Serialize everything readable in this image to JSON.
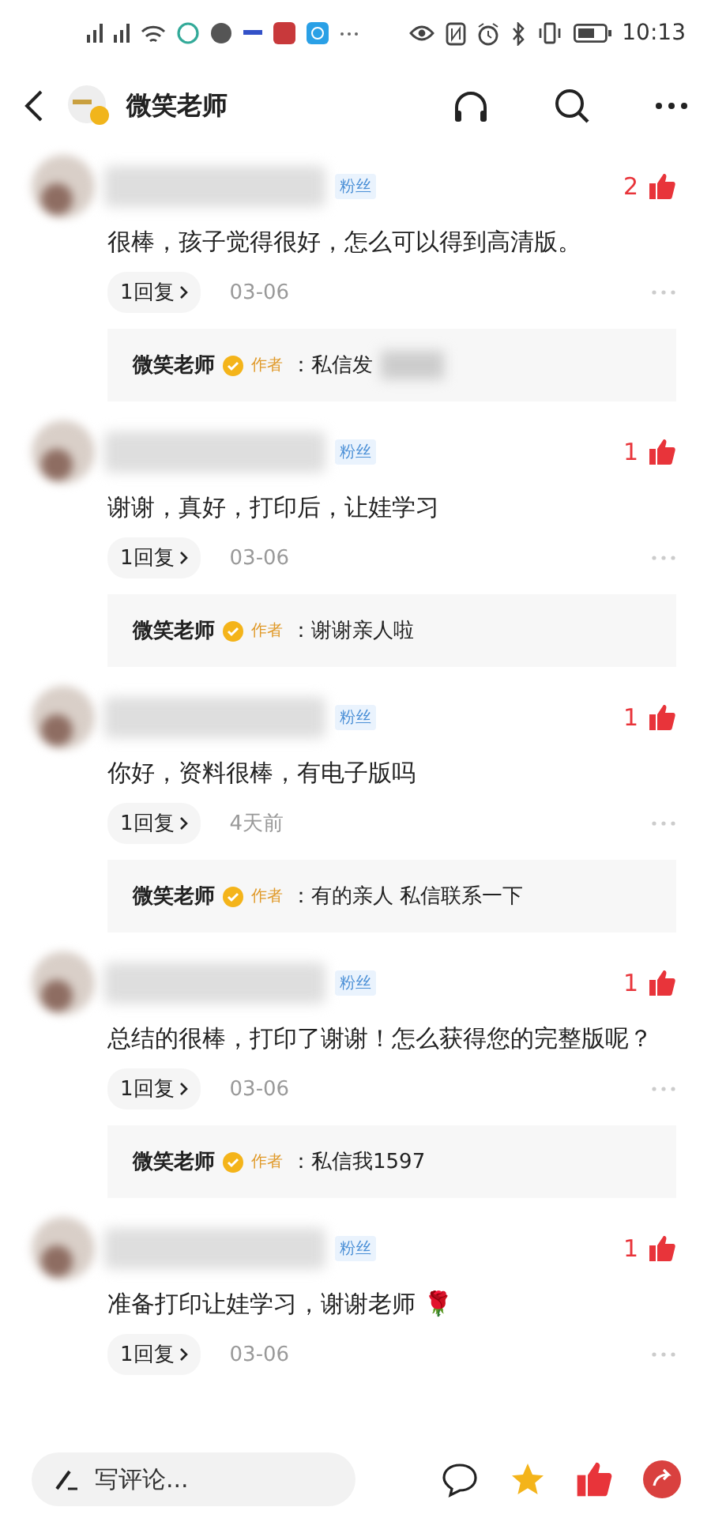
{
  "status_bar": {
    "time": "10:13"
  },
  "header": {
    "title": "微笑老师"
  },
  "comments": [
    {
      "fan_tag": "粉丝",
      "likes": "2",
      "text": "很棒，孩子觉得很好，怎么可以得到高清版。",
      "replies": "1回复",
      "date": "03-06",
      "author_reply": {
        "name": "微笑老师",
        "tag": "作者",
        "text": "：私信发",
        "redacted": true
      }
    },
    {
      "fan_tag": "粉丝",
      "likes": "1",
      "text": "谢谢，真好，打印后，让娃学习",
      "replies": "1回复",
      "date": "03-06",
      "author_reply": {
        "name": "微笑老师",
        "tag": "作者",
        "text": "：谢谢亲人啦",
        "redacted": false
      }
    },
    {
      "fan_tag": "粉丝",
      "likes": "1",
      "text": "你好，资料很棒，有电子版吗",
      "replies": "1回复",
      "date": "4天前",
      "author_reply": {
        "name": "微笑老师",
        "tag": "作者",
        "text": "：有的亲人 私信联系一下",
        "redacted": false
      }
    },
    {
      "fan_tag": "粉丝",
      "likes": "1",
      "text": "总结的很棒，打印了谢谢！怎么获得您的完整版呢？",
      "replies": "1回复",
      "date": "03-06",
      "author_reply": {
        "name": "微笑老师",
        "tag": "作者",
        "text": "：私信我1597",
        "redacted": false
      }
    },
    {
      "fan_tag": "粉丝",
      "likes": "1",
      "text": "准备打印让娃学习，谢谢老师",
      "emoji": "🌹",
      "replies": "1回复",
      "date": "03-06"
    }
  ],
  "comment_bar": {
    "placeholder": "写评论..."
  }
}
